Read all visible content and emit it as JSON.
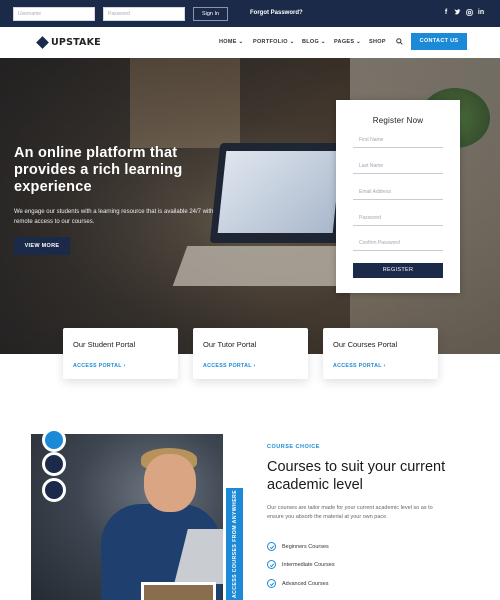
{
  "topbar": {
    "username_placeholder": "Username",
    "password_placeholder": "Password",
    "signin_label": "Sign In",
    "forgot_label": "Forgot Password?",
    "social_icons": [
      "facebook-icon",
      "twitter-icon",
      "instagram-icon",
      "linkedin-icon"
    ]
  },
  "nav": {
    "logo": "UPSTAKE",
    "items": [
      "HOME",
      "PORTFOLIO",
      "BLOG",
      "PAGES",
      "SHOP"
    ],
    "contact_label": "CONTACT US"
  },
  "hero": {
    "title": "An online platform that provides a rich learning experience",
    "subtitle": "We engage our students with a learning resource that is available 24/7 with remote access to our courses.",
    "button_label": "VIEW MORE"
  },
  "register": {
    "title": "Register Now",
    "fields": [
      "First Name",
      "Last Name",
      "Email Address",
      "Password",
      "Confirm Password"
    ],
    "button_label": "REGISTER"
  },
  "portals": [
    {
      "title": "Our Student Portal",
      "link": "ACCESS PORTAL ›"
    },
    {
      "title": "Our Tutor Portal",
      "link": "ACCESS PORTAL ›"
    },
    {
      "title": "Our Courses Portal",
      "link": "ACCESS PORTAL ›"
    }
  ],
  "courses": {
    "badge": "COURSE CHOICE",
    "title": "Courses to suit your current academic level",
    "text": "Our courses are tailor made for your current academic level so as to ensure you absorb the material at your own pace.",
    "features": [
      "Beginners Courses",
      "Intermediate Courses",
      "Advanced Courses"
    ],
    "side_label": "ACCESS COURSES FROM ANYWHERE"
  },
  "colors": {
    "navy": "#1c2a4a",
    "accent_blue": "#1c8ad6"
  }
}
